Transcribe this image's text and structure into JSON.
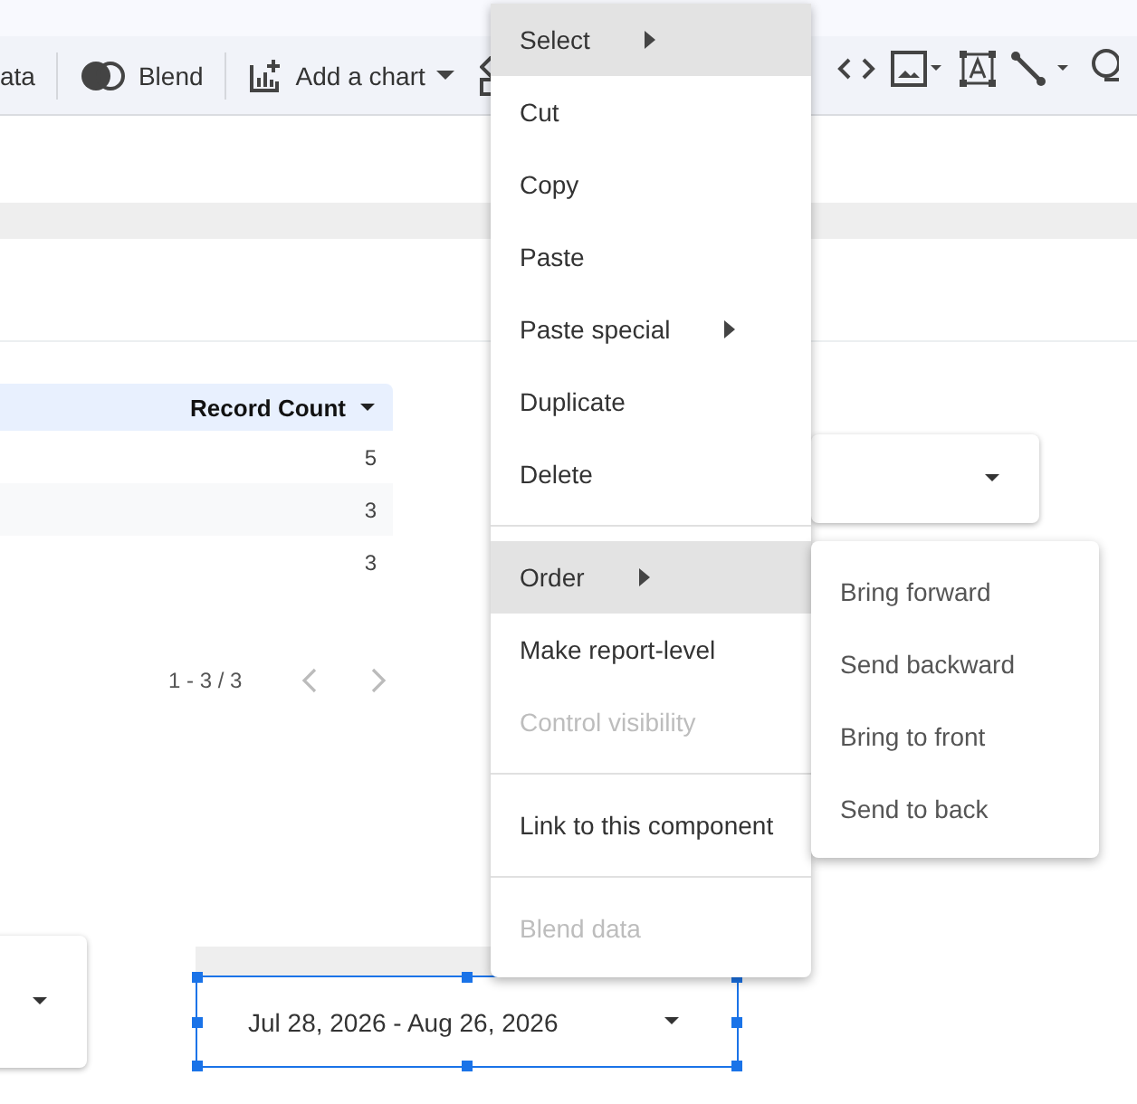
{
  "toolbar": {
    "items": [
      {
        "kind": "text",
        "label": "ata"
      },
      {
        "kind": "blend",
        "label": "Blend"
      },
      {
        "kind": "chart",
        "label": "Add a chart"
      }
    ]
  },
  "table": {
    "header": "Record Count",
    "rows": [
      {
        "value": "5"
      },
      {
        "value": "3"
      },
      {
        "value": "3"
      }
    ],
    "pagination": "1 - 3 / 3"
  },
  "date_control": {
    "value": "Jul 28, 2026 - Aug 26, 2026",
    "selected": true
  },
  "context_menu": {
    "items": [
      {
        "kind": "item",
        "label": "Select",
        "submenu": true,
        "selected": true,
        "disabled": false
      },
      {
        "kind": "item",
        "label": "Cut",
        "submenu": false,
        "selected": false,
        "disabled": false
      },
      {
        "kind": "item",
        "label": "Copy",
        "submenu": false,
        "selected": false,
        "disabled": false
      },
      {
        "kind": "item",
        "label": "Paste",
        "submenu": false,
        "selected": false,
        "disabled": false
      },
      {
        "kind": "item",
        "label": "Paste special",
        "submenu": true,
        "selected": false,
        "disabled": false
      },
      {
        "kind": "item",
        "label": "Duplicate",
        "submenu": false,
        "selected": false,
        "disabled": false
      },
      {
        "kind": "item",
        "label": "Delete",
        "submenu": false,
        "selected": false,
        "disabled": false
      },
      {
        "kind": "divider"
      },
      {
        "kind": "item",
        "label": "Order",
        "submenu": true,
        "selected": true,
        "disabled": false
      },
      {
        "kind": "item",
        "label": "Make report-level",
        "submenu": false,
        "selected": false,
        "disabled": false
      },
      {
        "kind": "item",
        "label": "Control visibility",
        "submenu": false,
        "selected": false,
        "disabled": true
      },
      {
        "kind": "divider"
      },
      {
        "kind": "item",
        "label": "Link to this component",
        "submenu": false,
        "selected": false,
        "disabled": false
      },
      {
        "kind": "divider"
      },
      {
        "kind": "item",
        "label": "Blend data",
        "submenu": false,
        "selected": false,
        "disabled": true
      }
    ]
  },
  "submenu": {
    "items": [
      {
        "label": "Bring forward"
      },
      {
        "label": "Send backward"
      },
      {
        "label": "Bring to front"
      },
      {
        "label": "Send to back"
      }
    ]
  }
}
